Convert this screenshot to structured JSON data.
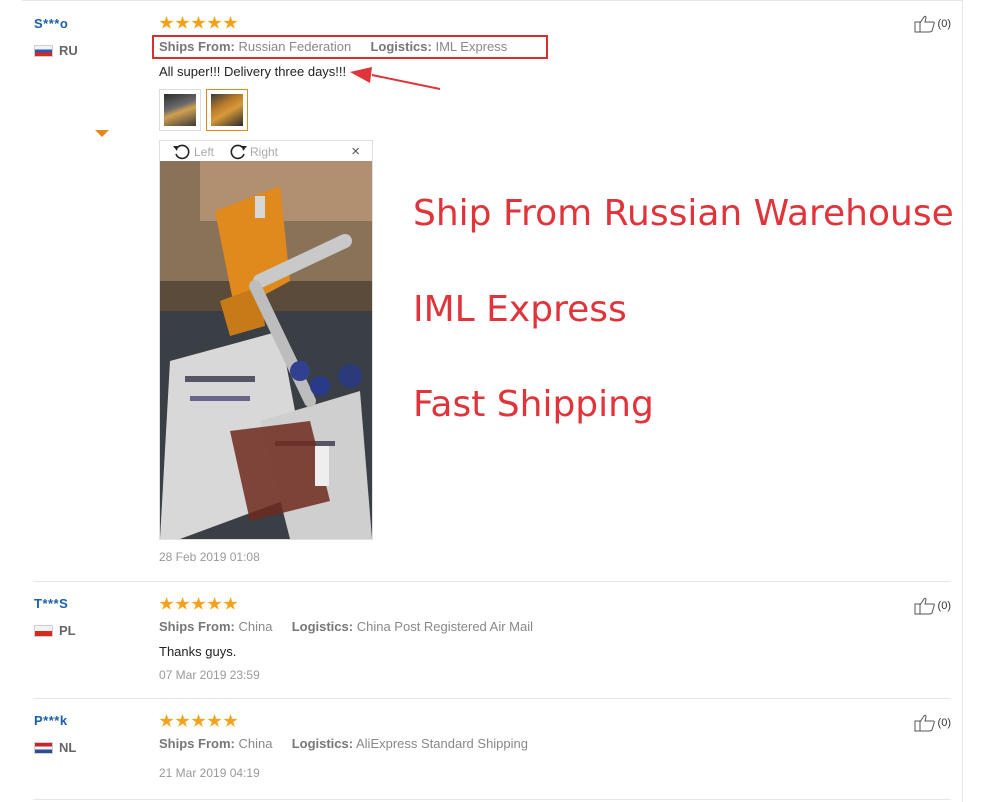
{
  "reviews": [
    {
      "user": "S***o",
      "country": "RU",
      "rating": 5,
      "ships_from_label": "Ships From:",
      "ships_from": "Russian Federation",
      "logistics_label": "Logistics:",
      "logistics": "IML Express",
      "comment": "All super!!! Delivery three days!!!",
      "date": "28 Feb 2019 01:08",
      "helpful_count": "(0)",
      "viewer": {
        "left_label": "Left",
        "right_label": "Right",
        "close": "×"
      }
    },
    {
      "user": "T***S",
      "country": "PL",
      "rating": 5,
      "ships_from_label": "Ships From:",
      "ships_from": "China",
      "logistics_label": "Logistics:",
      "logistics": "China Post Registered Air Mail",
      "comment": "Thanks guys.",
      "date": "07 Mar 2019 23:59",
      "helpful_count": "(0)"
    },
    {
      "user": "P***k",
      "country": "NL",
      "rating": 5,
      "ships_from_label": "Ships From:",
      "ships_from": "China",
      "logistics_label": "Logistics:",
      "logistics": "AliExpress Standard Shipping",
      "comment": "",
      "date": "21 Mar 2019 04:19",
      "helpful_count": "(0)"
    }
  ],
  "annotation": {
    "lines": [
      "Ship From Russian Warehouse",
      "IML Express",
      "Fast Shipping"
    ],
    "color": "#e0333a"
  },
  "icons": {
    "star": "star-icon",
    "thumb": "thumbs-up-icon",
    "rotate_left": "rotate-left-icon",
    "rotate_right": "rotate-right-icon",
    "close": "close-icon"
  },
  "colors": {
    "username": "#1a5fa8",
    "star": "#f4a21c",
    "highlight": "#d9302c",
    "active_thumb_border": "#e08a1e"
  }
}
